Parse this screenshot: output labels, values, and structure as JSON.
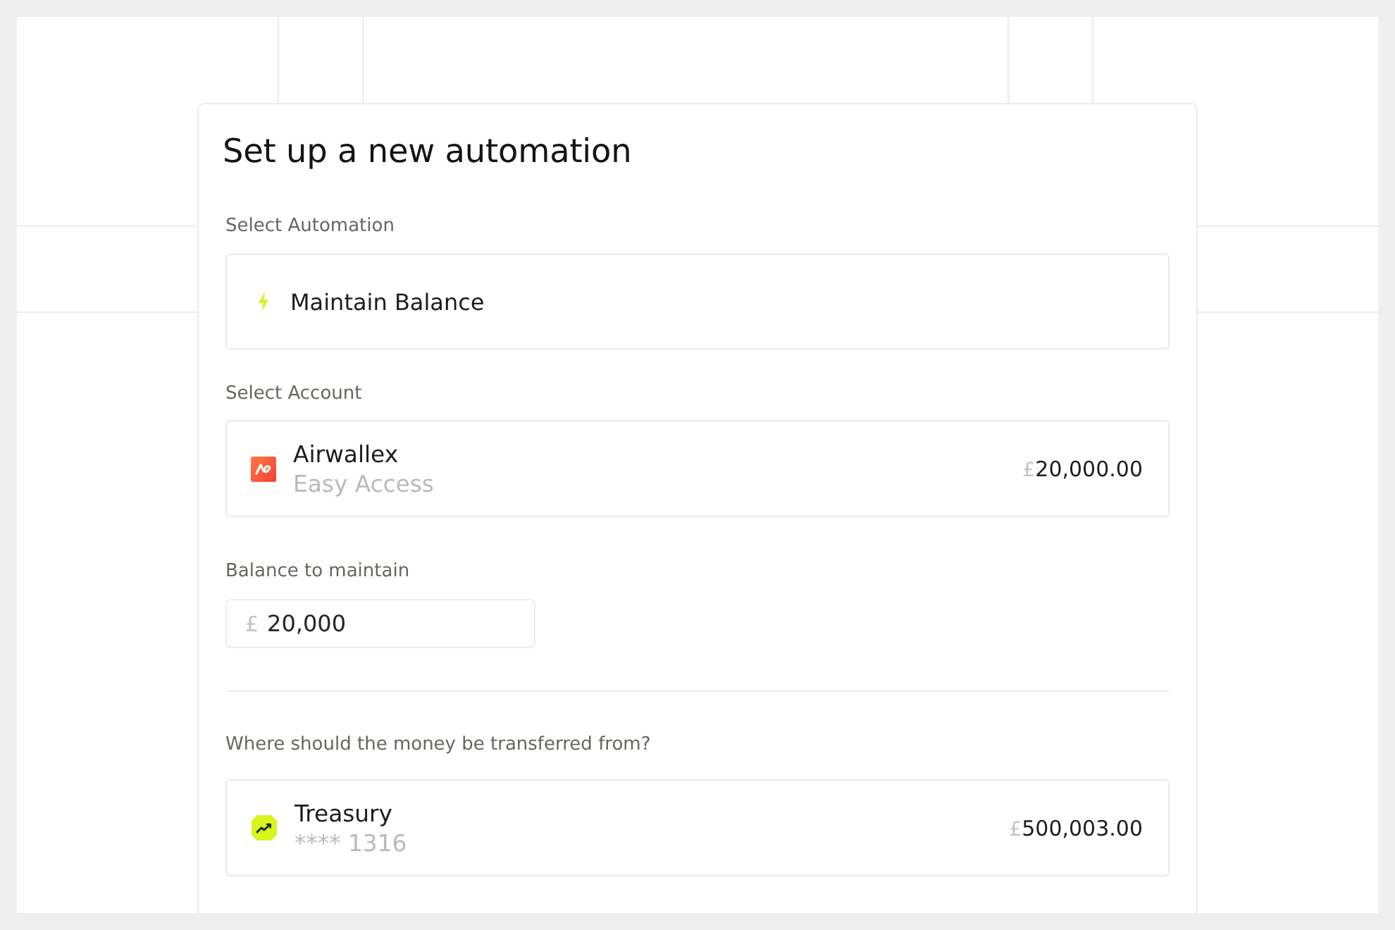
{
  "title": "Set up a new automation",
  "automation": {
    "label": "Select Automation",
    "value": "Maintain Balance"
  },
  "account": {
    "label": "Select Account",
    "name": "Airwallex",
    "detail": "Easy Access",
    "currency": "£",
    "amount": "20,000.00"
  },
  "balance": {
    "label": "Balance to maintain",
    "currency": "£",
    "value": "20,000"
  },
  "source": {
    "label": "Where should the money be transferred from?",
    "name": "Treasury",
    "detail": "**** 1316",
    "currency": "£",
    "amount": "500,003.00"
  }
}
